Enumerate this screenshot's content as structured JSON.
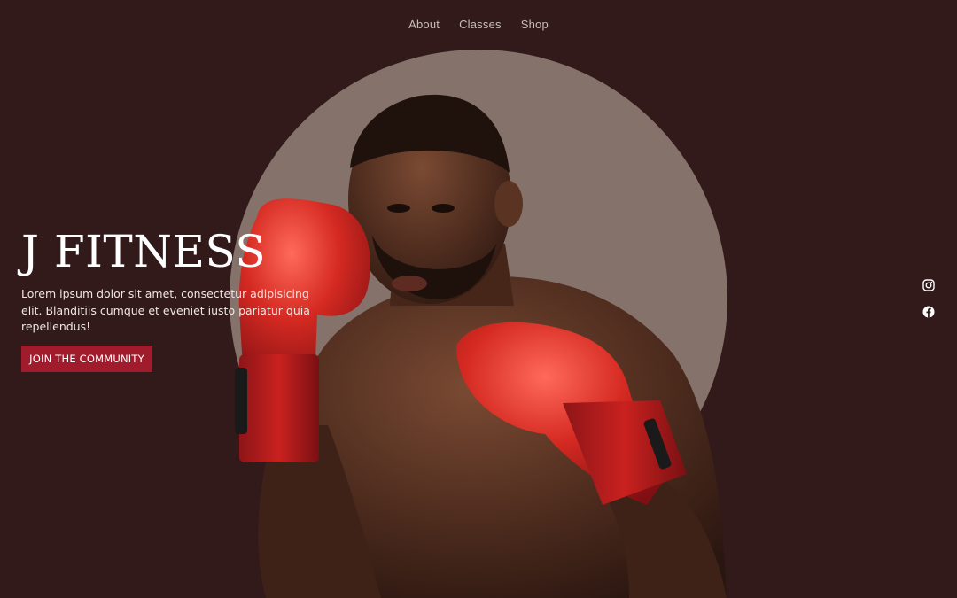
{
  "nav": {
    "items": [
      {
        "label": "About"
      },
      {
        "label": "Classes"
      },
      {
        "label": "Shop"
      }
    ]
  },
  "hero": {
    "title": "J FITNESS",
    "description": "Lorem ipsum dolor sit amet, consectetur adipisicing elit. Blanditiis cumque et eveniet iusto pariatur quia repellendus!",
    "cta_label": "JOIN THE COMMUNITY",
    "image_icon": "boxer-photo"
  },
  "social": {
    "items": [
      {
        "icon": "instagram-icon"
      },
      {
        "icon": "facebook-icon"
      }
    ]
  },
  "colors": {
    "background": "#321a1a",
    "circle": "#85726b",
    "accent": "#a01b2b",
    "glove": "#c41f1f",
    "text": "#ffffff",
    "nav_text": "#c8bdbd"
  }
}
